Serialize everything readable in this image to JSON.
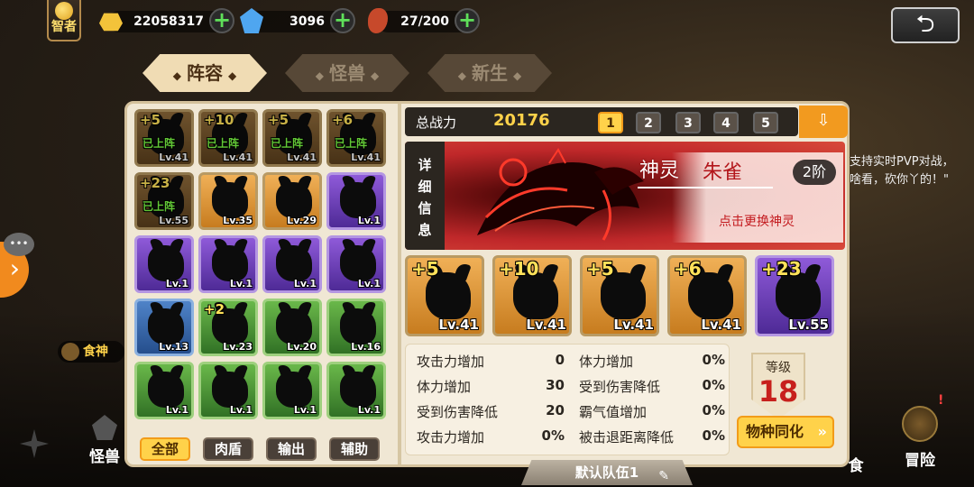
{
  "topbar": {
    "rank_label": "智者",
    "gold": "22058317",
    "gems": "3096",
    "stamina": "27/200",
    "plus": "+",
    "back_icon": "back-arrow-icon"
  },
  "tabs": [
    {
      "label": "阵容",
      "active": true
    },
    {
      "label": "怪兽",
      "active": false
    },
    {
      "label": "新生",
      "active": false
    }
  ],
  "monster_grid": [
    {
      "star": "+5",
      "on_team": "已上阵",
      "level": "Lv.41",
      "color": "brown"
    },
    {
      "star": "+10",
      "on_team": "已上阵",
      "level": "Lv.41",
      "color": "brown"
    },
    {
      "star": "+5",
      "on_team": "已上阵",
      "level": "Lv.41",
      "color": "brown"
    },
    {
      "star": "+6",
      "on_team": "已上阵",
      "level": "Lv.41",
      "color": "brown"
    },
    {
      "star": "+23",
      "on_team": "已上阵",
      "level": "Lv.55",
      "color": "brown"
    },
    {
      "star": "",
      "on_team": "",
      "level": "Lv.35",
      "color": "orange"
    },
    {
      "star": "",
      "on_team": "",
      "level": "Lv.29",
      "color": "orange"
    },
    {
      "star": "",
      "on_team": "",
      "level": "Lv.1",
      "color": "purple"
    },
    {
      "star": "",
      "on_team": "",
      "level": "Lv.1",
      "color": "purple"
    },
    {
      "star": "",
      "on_team": "",
      "level": "Lv.1",
      "color": "purple"
    },
    {
      "star": "",
      "on_team": "",
      "level": "Lv.1",
      "color": "purple"
    },
    {
      "star": "",
      "on_team": "",
      "level": "Lv.1",
      "color": "purple"
    },
    {
      "star": "",
      "on_team": "",
      "level": "Lv.13",
      "color": "blue"
    },
    {
      "star": "+2",
      "on_team": "",
      "level": "Lv.23",
      "color": "green"
    },
    {
      "star": "",
      "on_team": "",
      "level": "Lv.20",
      "color": "green"
    },
    {
      "star": "",
      "on_team": "",
      "level": "Lv.16",
      "color": "green"
    },
    {
      "star": "",
      "on_team": "",
      "level": "Lv.1",
      "color": "green"
    },
    {
      "star": "",
      "on_team": "",
      "level": "Lv.1",
      "color": "green"
    },
    {
      "star": "",
      "on_team": "",
      "level": "Lv.1",
      "color": "green"
    },
    {
      "star": "",
      "on_team": "",
      "level": "Lv.1",
      "color": "green"
    }
  ],
  "filters": [
    {
      "label": "全部",
      "active": true
    },
    {
      "label": "肉盾",
      "active": false
    },
    {
      "label": "输出",
      "active": false
    },
    {
      "label": "辅助",
      "active": false
    }
  ],
  "power": {
    "label": "总战力",
    "value": "20176"
  },
  "team_tabs": [
    "1",
    "2",
    "3",
    "4",
    "5"
  ],
  "active_team": "1",
  "detail": {
    "side_label": [
      "详",
      "细",
      "信",
      "息"
    ],
    "god_type": "神灵",
    "god_name": "朱雀",
    "tier": "2阶",
    "hint": "点击更换神灵"
  },
  "team_slots": [
    {
      "star": "+5",
      "level": "Lv.41",
      "color": "orange"
    },
    {
      "star": "+10",
      "level": "Lv.41",
      "color": "orange"
    },
    {
      "star": "+5",
      "level": "Lv.41",
      "color": "orange"
    },
    {
      "star": "+6",
      "level": "Lv.41",
      "color": "orange"
    },
    {
      "star": "+23",
      "level": "Lv.55",
      "color": "purple"
    }
  ],
  "stats_left": [
    {
      "label": "攻击力增加",
      "value": "0"
    },
    {
      "label": "体力增加",
      "value": "30"
    },
    {
      "label": "受到伤害降低",
      "value": "20"
    },
    {
      "label": "攻击力增加",
      "value": "0%"
    }
  ],
  "stats_right": [
    {
      "label": "体力增加",
      "value": "0%"
    },
    {
      "label": "受到伤害降低",
      "value": "0%"
    },
    {
      "label": "霸气值增加",
      "value": "0%"
    },
    {
      "label": "被击退距离降低",
      "value": "0%"
    }
  ],
  "level": {
    "label": "等级",
    "value": "18"
  },
  "species_button": "物种同化",
  "team_name": "默认队伍1",
  "background": {
    "chef_label": "食神",
    "pvp_text": "支持实时PVP对战，",
    "pvp_text2": "啥看，砍你丫的！\"",
    "nav_left": "怪兽",
    "nav_right1": "食",
    "nav_right2": "冒险"
  }
}
